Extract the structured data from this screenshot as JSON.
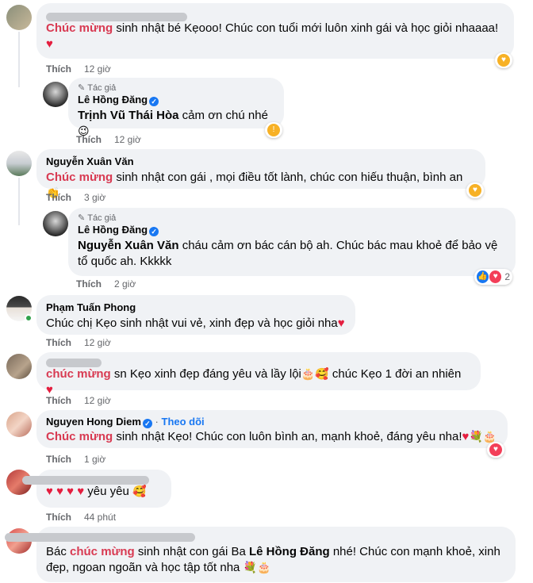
{
  "comments": [
    {
      "name_hidden": true,
      "highlight": "Chúc mừng",
      "text": " sinh nhật bé Kẹooo! Chúc con tuổi mới luôn xinh gái và học giỏi nhaaaa!",
      "heart": "♥",
      "like": "Thích",
      "time": "12 giờ"
    },
    {
      "author_tag": "Tác giả",
      "name": "Lê Hồng Đăng",
      "mention": "Trịnh Vũ Thái Hòa",
      "text": " cảm ơn chú nhé",
      "like": "Thích",
      "time": "12 giờ"
    },
    {
      "name": "Nguyễn Xuân Văn",
      "highlight": "Chúc mừng",
      "text": " sinh nhật con gái , mọi điều tốt lành, chúc con hiếu thuận, bình an",
      "like": "Thích",
      "time": "3 giờ"
    },
    {
      "author_tag": "Tác giả",
      "name": "Lê Hồng Đăng",
      "mention": "Nguyễn Xuân Văn",
      "text": " cháu cảm ơn bác cán bộ ah. Chúc bác mau khoẻ để bảo vệ tổ quốc ah. Kkkkk",
      "like": "Thích",
      "time": "2 giờ",
      "reaction_count": "2"
    },
    {
      "name": "Phạm Tuấn Phong",
      "text": "Chúc chị Kẹo sinh nhật vui vẻ, xinh đẹp và học giỏi nha",
      "heart": "♥",
      "like": "Thích",
      "time": "12 giờ"
    },
    {
      "name_hidden": true,
      "highlight": "chúc mừng",
      "text": " sn Kẹo xinh đẹp đáng yêu và lầy lội",
      "text2": " chúc Kẹo 1 đời an nhiên",
      "heart": "♥",
      "like": "Thích",
      "time": "12 giờ"
    },
    {
      "name": "Nguyen Hong Diem",
      "follow": "Theo dõi",
      "dot": "·",
      "highlight": "Chúc mừng",
      "text": " sinh nhật Kẹo! Chúc con luôn bình an, mạnh khoẻ, đáng yêu nha!",
      "heart": "♥",
      "like": "Thích",
      "time": "1 giờ"
    },
    {
      "name_hidden": true,
      "hearts": "♥ ♥ ♥ ♥",
      "text": " yêu yêu",
      "like": "Thích",
      "time": "44 phút"
    },
    {
      "name_hidden": true,
      "prefix": "Bác ",
      "highlight": "chúc mừng",
      "text": " sinh nhật con gái Ba ",
      "mention": "Lê Hồng Đăng",
      "text2": " nhé! Chúc con mạnh khoẻ, xinh đẹp, ngoan ngoãn và học tập tốt nha"
    }
  ],
  "colors": {
    "highlight": "#d83a52",
    "bubble": "#f0f2f5",
    "meta": "#65676b",
    "link": "#1877f2"
  }
}
